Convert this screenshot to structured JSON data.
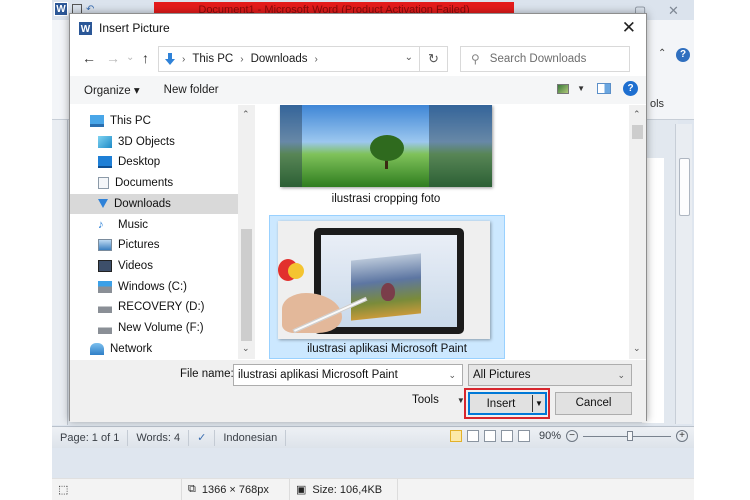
{
  "word": {
    "title": "Document1 - Microsoft Word (Product Activation Failed)",
    "logo": "W",
    "ribbon_tools_label": "ols",
    "help_glyph": "?",
    "status": {
      "page": "Page: 1 of 1",
      "words": "Words: 4",
      "language": "Indonesian",
      "zoom": "90%",
      "zoom_minus": "−",
      "zoom_plus": "+"
    }
  },
  "viewer": {
    "dimensions": "1366 × 768px",
    "size": "Size: 106,4KB"
  },
  "dialog": {
    "title": "Insert Picture",
    "close_glyph": "✕",
    "nav": {
      "back": "←",
      "forward": "→",
      "recent": "⌄",
      "up": "↑",
      "breadcrumb": [
        "This PC",
        "Downloads"
      ],
      "crumb_sep": "›",
      "dropdown": "⌄",
      "refresh": "↻"
    },
    "search": {
      "placeholder": "Search Downloads",
      "icon": "⚲"
    },
    "toolbar": {
      "organize": "Organize ▾",
      "new_folder": "New folder",
      "help": "?"
    },
    "sidebar": {
      "items": [
        {
          "label": "This PC",
          "icon": "computer-icon"
        },
        {
          "label": "3D Objects",
          "icon": "3d-objects-icon"
        },
        {
          "label": "Desktop",
          "icon": "desktop-icon"
        },
        {
          "label": "Documents",
          "icon": "documents-icon"
        },
        {
          "label": "Downloads",
          "icon": "downloads-icon",
          "selected": true
        },
        {
          "label": "Music",
          "icon": "music-icon"
        },
        {
          "label": "Pictures",
          "icon": "pictures-icon"
        },
        {
          "label": "Videos",
          "icon": "videos-icon"
        },
        {
          "label": "Windows (C:)",
          "icon": "drive-windows-icon"
        },
        {
          "label": "RECOVERY (D:)",
          "icon": "drive-icon"
        },
        {
          "label": "New Volume (F:)",
          "icon": "drive-icon"
        },
        {
          "label": "Network",
          "icon": "network-icon"
        }
      ]
    },
    "files": [
      {
        "name": "ilustrasi cropping foto",
        "selected": false
      },
      {
        "name": "ilustrasi aplikasi Microsoft Paint",
        "selected": true
      }
    ],
    "file_name_label": "File name:",
    "file_name_value": "ilustrasi aplikasi Microsoft Paint",
    "filter_value": "All Pictures",
    "tools_label": "Tools",
    "insert_label": "Insert",
    "cancel_label": "Cancel",
    "highlight_color": "#d7262d",
    "accent_color": "#0078d7"
  }
}
